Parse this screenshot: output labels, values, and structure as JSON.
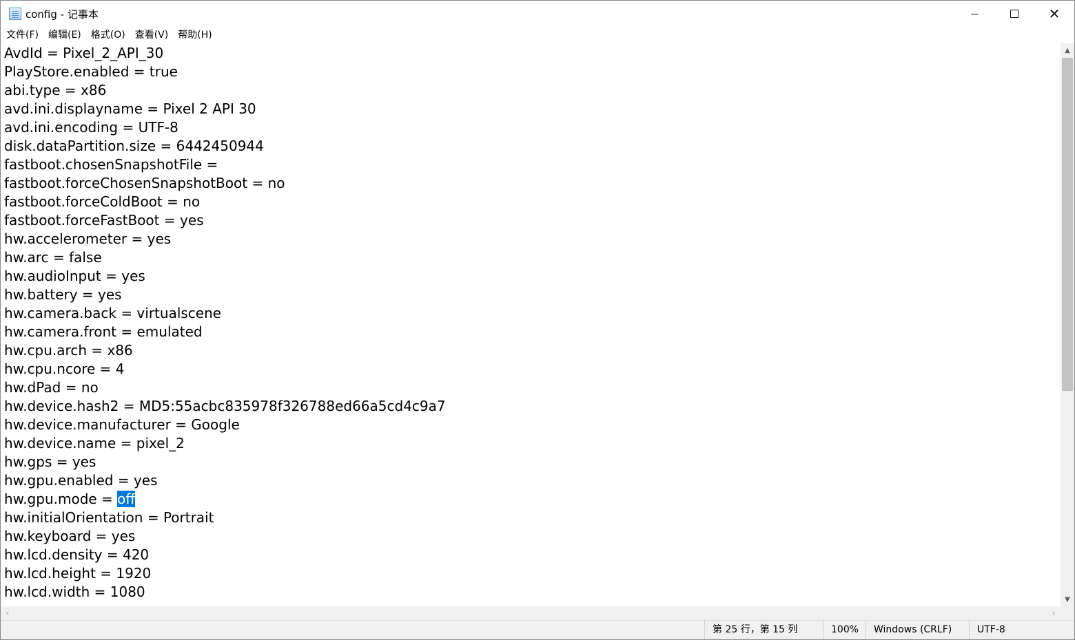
{
  "window": {
    "title": "config - 记事本",
    "minimize_icon": "minimize-icon",
    "maximize_icon": "maximize-icon",
    "close_icon": "close-icon"
  },
  "menu": {
    "items": [
      "文件(F)",
      "编辑(E)",
      "格式(O)",
      "查看(V)",
      "帮助(H)"
    ]
  },
  "editor": {
    "lines": [
      "AvdId = Pixel_2_API_30",
      "PlayStore.enabled = true",
      "abi.type = x86",
      "avd.ini.displayname = Pixel 2 API 30",
      "avd.ini.encoding = UTF-8",
      "disk.dataPartition.size = 6442450944",
      "fastboot.chosenSnapshotFile = ",
      "fastboot.forceChosenSnapshotBoot = no",
      "fastboot.forceColdBoot = no",
      "fastboot.forceFastBoot = yes",
      "hw.accelerometer = yes",
      "hw.arc = false",
      "hw.audioInput = yes",
      "hw.battery = yes",
      "hw.camera.back = virtualscene",
      "hw.camera.front = emulated",
      "hw.cpu.arch = x86",
      "hw.cpu.ncore = 4",
      "hw.dPad = no",
      "hw.device.hash2 = MD5:55acbc835978f326788ed66a5cd4c9a7",
      "hw.device.manufacturer = Google",
      "hw.device.name = pixel_2",
      "hw.gps = yes",
      "hw.gpu.enabled = yes",
      "hw.gpu.mode = ",
      "hw.initialOrientation = Portrait",
      "hw.keyboard = yes",
      "hw.lcd.density = 420",
      "hw.lcd.height = 1920",
      "hw.lcd.width = 1080"
    ],
    "selected_text": "off"
  },
  "status": {
    "position": "第 25 行，第 15 列",
    "zoom": "100%",
    "line_ending": "Windows (CRLF)",
    "encoding": "UTF-8"
  },
  "colors": {
    "selection": "#0078d7"
  }
}
